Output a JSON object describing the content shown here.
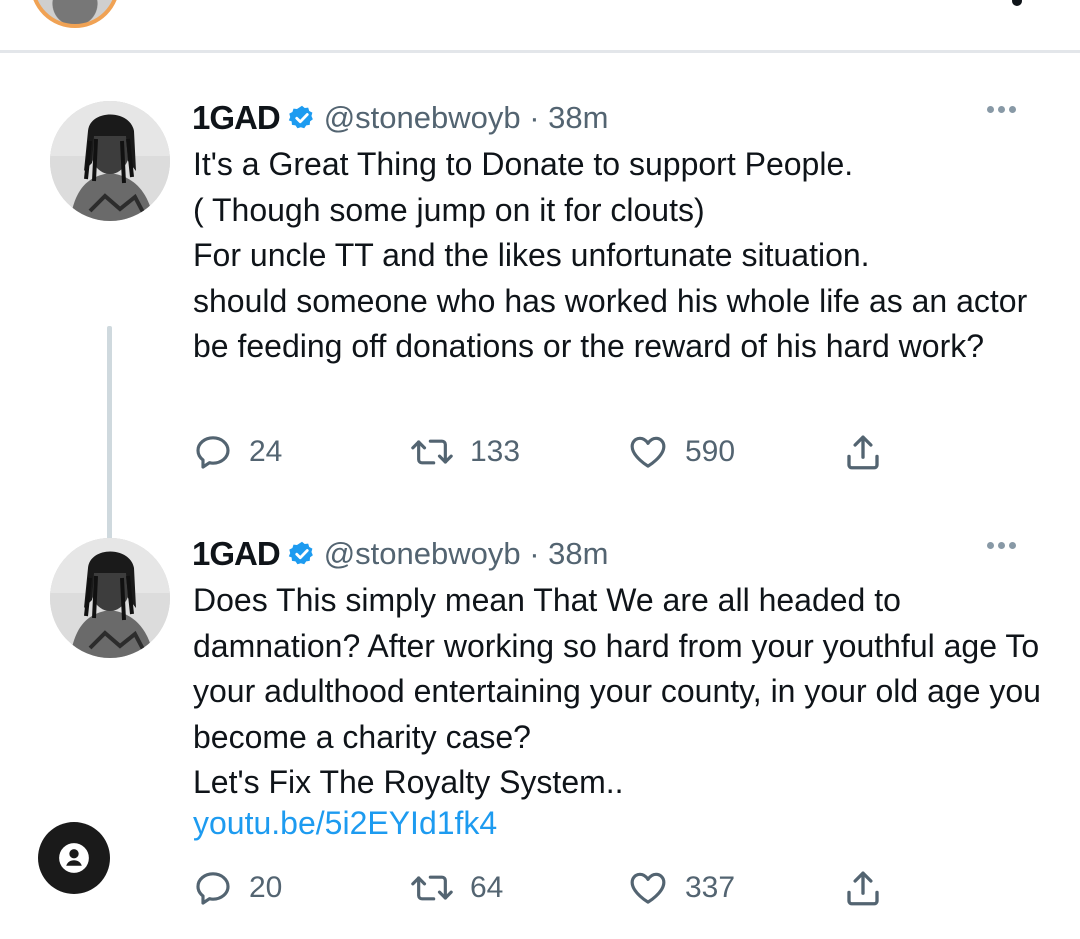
{
  "tweets": [
    {
      "name": "1GAD",
      "handle_time": "@stonebwoyb · 38m",
      "text": "It's a Great Thing to Donate to support People.\n( Though some jump on it for clouts)\nFor uncle TT and the likes unfortunate situation.\n should someone who has worked his whole life as an actor be feeding off donations or the reward of his hard work?",
      "replies": "24",
      "retweets": "133",
      "likes": "590"
    },
    {
      "name": "1GAD",
      "handle_time": "@stonebwoyb · 38m",
      "text": "Does This simply mean That We are all headed to damnation? After working so hard from your youthful age To your adulthood entertaining your county, in your old age you become a charity case?\nLet's Fix The Royalty System..",
      "link": "youtu.be/5i2EYId1fk4",
      "replies": "20",
      "retweets": "64",
      "likes": "337"
    }
  ],
  "colors": {
    "link": "#1d9bf0",
    "verified": "#1d9bf0",
    "secondary_text": "#536471",
    "thread_line": "#cfd9de"
  },
  "icons": [
    "reply-icon",
    "retweet-icon",
    "like-icon",
    "share-icon",
    "verified-badge-icon",
    "more-options-icon",
    "account-icon"
  ]
}
